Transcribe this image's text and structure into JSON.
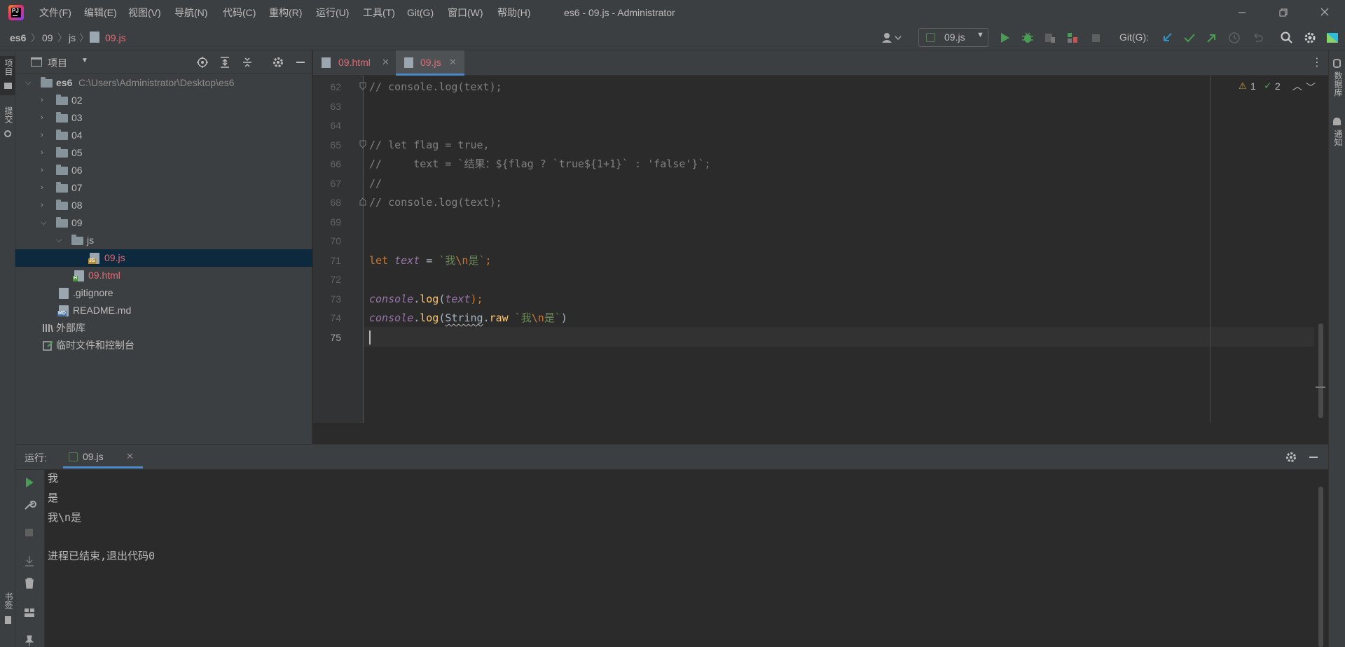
{
  "titlebar": {
    "menu": [
      "文件(F)",
      "编辑(E)",
      "视图(V)",
      "导航(N)",
      "代码(C)",
      "重构(R)",
      "运行(U)",
      "工具(T)",
      "Git(G)",
      "窗口(W)",
      "帮助(H)"
    ],
    "window_title": "es6 - 09.js - Administrator"
  },
  "navbar": {
    "breadcrumb": [
      "es6",
      "09",
      "js",
      "09.js"
    ],
    "run_config": "09.js",
    "git_label": "Git(G):"
  },
  "left_stripe": {
    "project": "项目",
    "commit": "提交",
    "bookmarks": "书签"
  },
  "right_stripe": {
    "database": "数据库",
    "notifications": "通知"
  },
  "project_panel": {
    "title": "项目",
    "root_name": "es6",
    "root_path": "C:\\Users\\Administrator\\Desktop\\es6",
    "folders": [
      "02",
      "03",
      "04",
      "05",
      "06",
      "07",
      "08",
      "09"
    ],
    "subfolder": "js",
    "file_js": "09.js",
    "file_html": "09.html",
    "file_gitignore": ".gitignore",
    "file_readme": "README.md",
    "external_libs": "外部库",
    "scratches": "临时文件和控制台"
  },
  "tabs": [
    {
      "label": "09.html",
      "active": false
    },
    {
      "label": "09.js",
      "active": true
    }
  ],
  "editor": {
    "line_numbers": [
      "62",
      "63",
      "64",
      "65",
      "66",
      "67",
      "68",
      "69",
      "70",
      "71",
      "72",
      "73",
      "74",
      "75"
    ],
    "current_line": "75",
    "inspections": {
      "warnings": "1",
      "ok": "2"
    },
    "code": {
      "l62": "// console.log(text);",
      "l65": "// let flag = true,",
      "l66": "//     text = `结果：${flag ? `true${1+1}` : 'false'}`;",
      "l67": "//",
      "l68": "// console.log(text);",
      "l71_kw": "let",
      "l71_var": "text",
      "l71_eq": " = ",
      "l71_str_a": "`我",
      "l71_esc": "\\n",
      "l71_str_b": "是`",
      "l71_semi": ";",
      "l73_obj": "console",
      "l73_dot": ".",
      "l73_fn": "log",
      "l73_open": "(",
      "l73_arg": "text",
      "l73_close": ");",
      "l74_obj": "console",
      "l74_dot": ".",
      "l74_fn": "log",
      "l74_open": "(",
      "l74_cls": "String",
      "l74_dot2": ".",
      "l74_raw": "raw",
      "l74_sp": " ",
      "l74_str_a": "`我",
      "l74_esc": "\\n",
      "l74_str_b": "是`",
      "l74_close": ")"
    }
  },
  "run_panel": {
    "label": "运行:",
    "tab": "09.js",
    "output": [
      "我",
      "是",
      "我\\n是",
      "",
      "进程已结束,退出代码0"
    ]
  },
  "colors": {
    "accent_blue": "#4a88c7",
    "run_green": "#499c54",
    "vcs_red": "#e06c75"
  }
}
